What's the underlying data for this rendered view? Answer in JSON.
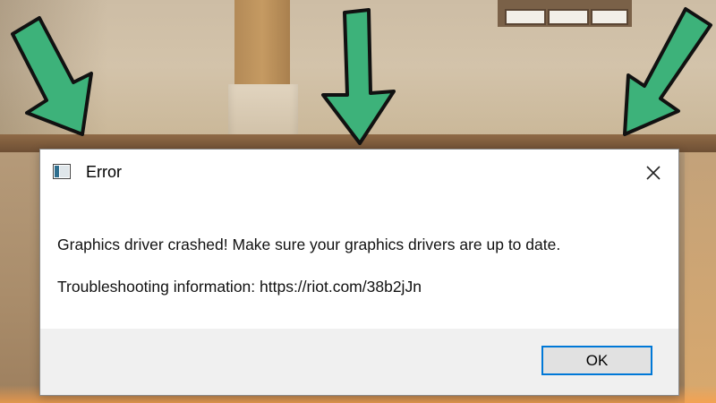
{
  "dialog": {
    "title": "Error",
    "message_line1": "Graphics driver crashed! Make sure your graphics drivers are up to date.",
    "message_line2": "Troubleshooting information: https://riot.com/38b2jJn",
    "ok_label": "OK",
    "close_icon": "close-icon",
    "window_icon": "app-window-icon"
  },
  "colors": {
    "arrow_fill": "#3db27a",
    "arrow_outline": "#111111",
    "ok_border": "#0078d7",
    "footer_bg": "#f0f0f0"
  }
}
